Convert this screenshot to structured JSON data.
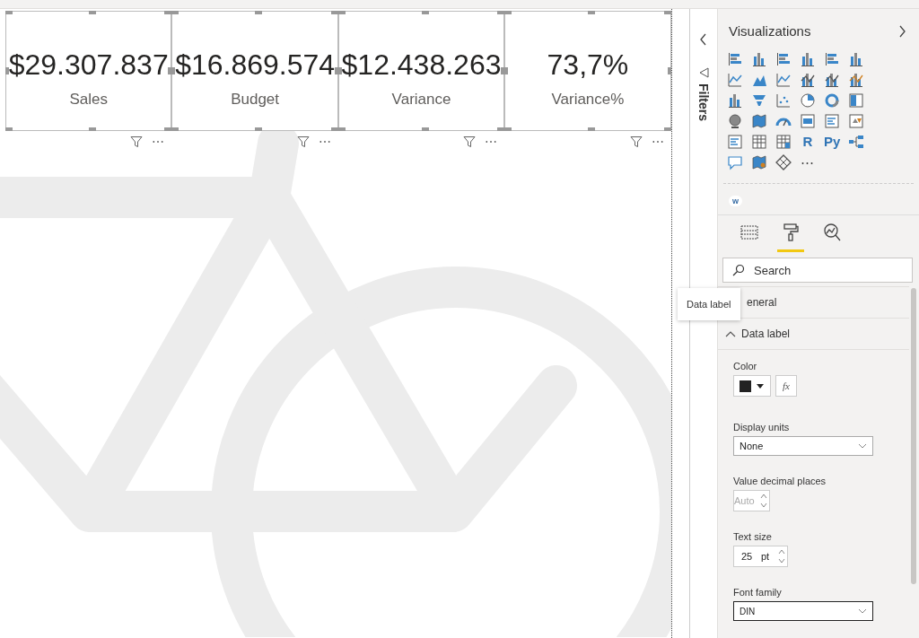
{
  "cards": [
    {
      "value": "$29.307.837",
      "label": "Sales",
      "more": "⋯"
    },
    {
      "value": "$16.869.574",
      "label": "Budget",
      "more": "⋯"
    },
    {
      "value": "$12.438.263",
      "label": "Variance",
      "more": "⋯"
    },
    {
      "value": "73,7%",
      "label": "Variance%",
      "more": "⋯"
    }
  ],
  "filters_pane": {
    "title": "Filters",
    "expanded": false
  },
  "visualizations": {
    "title": "Visualizations",
    "glyphs": [
      "R",
      "Py",
      "⋯"
    ],
    "custom_badge": "w",
    "tabs": [
      {
        "kind": "fields",
        "selected": false
      },
      {
        "kind": "format",
        "selected": true
      },
      {
        "kind": "analytics",
        "selected": false
      }
    ]
  },
  "format": {
    "search": {
      "placeholder": "Search"
    },
    "tooltip": "Data label",
    "sections": [
      {
        "title": "eneral",
        "expanded": false
      },
      {
        "title": "Data label",
        "expanded": true
      }
    ],
    "color": {
      "label": "Color",
      "color": "#222222",
      "fx": "fx"
    },
    "display_units": {
      "label": "Display units",
      "value": "None"
    },
    "decimal_places": {
      "label": "Value decimal places",
      "value": "Auto",
      "disabled": true
    },
    "text_size": {
      "label": "Text size",
      "value": "25",
      "unit": "pt"
    },
    "font_family": {
      "label": "Font family",
      "value": "DIN",
      "focused": true
    }
  }
}
